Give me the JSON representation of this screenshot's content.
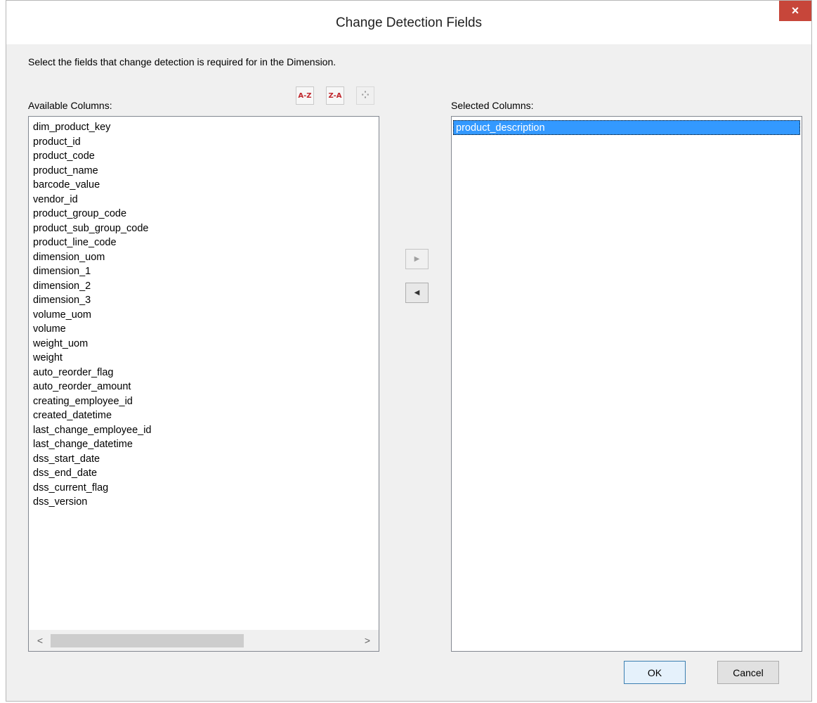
{
  "dialog": {
    "title": "Change Detection Fields",
    "close_label": "×",
    "instruction": "Select the fields that change detection is required for in the Dimension."
  },
  "available": {
    "label": "Available Columns:",
    "sort_az_label": "A-Z",
    "sort_za_label": "Z-A",
    "sort_custom_icon": "custom-sort-icon",
    "items": [
      "dim_product_key",
      "product_id",
      "product_code",
      "product_name",
      "barcode_value",
      "vendor_id",
      "product_group_code",
      "product_sub_group_code",
      "product_line_code",
      "dimension_uom",
      "dimension_1",
      "dimension_2",
      "dimension_3",
      "volume_uom",
      "volume",
      "weight_uom",
      "weight",
      "auto_reorder_flag",
      "auto_reorder_amount",
      "creating_employee_id",
      "created_datetime",
      "last_change_employee_id",
      "last_change_datetime",
      "dss_start_date",
      "dss_end_date",
      "dss_current_flag",
      "dss_version"
    ],
    "scroll_left": "<",
    "scroll_right": ">"
  },
  "selected": {
    "label": "Selected Columns:",
    "items": [
      "product_description"
    ],
    "selected_index": 0
  },
  "move": {
    "add_label": "▶",
    "remove_label": "◀"
  },
  "buttons": {
    "ok_label": "OK",
    "cancel_label": "Cancel"
  },
  "colors": {
    "close_button": "#c7463a",
    "selection": "#3399ff",
    "sort_icon": "#c0262c"
  }
}
